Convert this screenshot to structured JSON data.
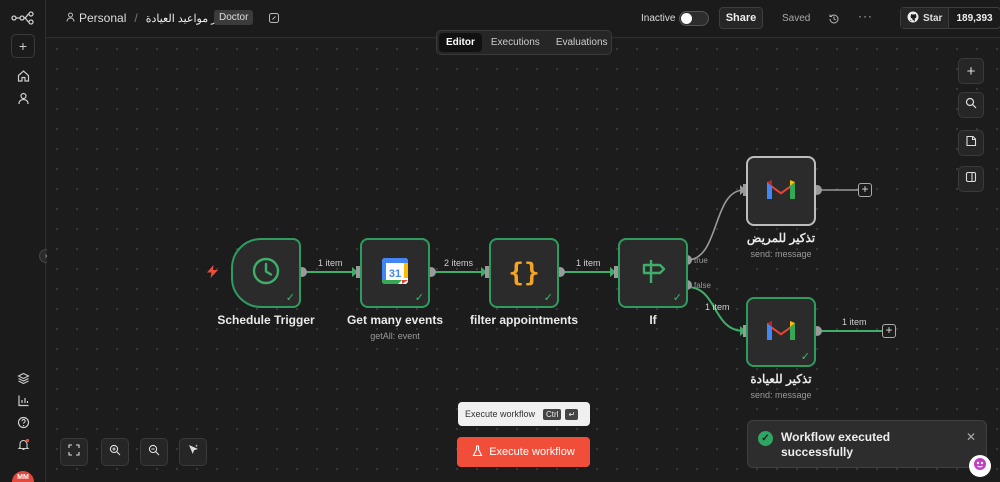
{
  "header": {
    "project": "Personal",
    "separator": "/",
    "workflow_name": "تذكير مواعيد العيادة",
    "tag": "Doctor",
    "status_label": "Inactive",
    "share_label": "Share",
    "saved_label": "Saved",
    "github_star_label": "Star",
    "github_star_count": "189,393"
  },
  "tabs": [
    {
      "label": "Editor",
      "active": true
    },
    {
      "label": "Executions",
      "active": false
    },
    {
      "label": "Evaluations",
      "active": false
    }
  ],
  "nodes": {
    "schedule": {
      "label": "Schedule Trigger"
    },
    "calendar": {
      "label": "Get many events",
      "sub": "getAll: event"
    },
    "filter": {
      "label": "filter appointments"
    },
    "if": {
      "label": "If"
    },
    "gmail_patient": {
      "label": "تذكير للمريض",
      "sub": "send: message"
    },
    "gmail_clinic": {
      "label": "تذكير للعيادة",
      "sub": "send: message"
    }
  },
  "edges": {
    "e1": "1 item",
    "e2": "2 items",
    "e3": "1 item",
    "true_label": "true",
    "false_label": "false",
    "e_false": "1 item",
    "e_clinic_out": "1 item"
  },
  "execute": {
    "tooltip": "Execute workflow",
    "key_ctrl": "Ctrl",
    "key_enter": "↵",
    "button_label": "Execute workflow"
  },
  "toast": {
    "message": "Workflow executed successfully"
  },
  "colors": {
    "accent_green": "#2f9c5f",
    "execute_red": "#f14e3a",
    "canvas_bg": "#1c1c1c"
  },
  "icons": [
    "n8n-logo-icon",
    "plus-icon",
    "home-icon",
    "user-icon",
    "templates-icon",
    "insights-icon",
    "help-icon",
    "bell-icon",
    "history-icon",
    "more-icon",
    "github-icon",
    "search-icon",
    "sticky-note-icon",
    "panel-icon",
    "fit-view-icon",
    "zoom-in-icon",
    "zoom-out-icon",
    "tidy-up-icon",
    "flask-icon",
    "clock-icon",
    "google-calendar-icon",
    "code-braces-icon",
    "signpost-icon",
    "gmail-icon",
    "bolt-icon",
    "check-circle-icon",
    "close-icon"
  ]
}
